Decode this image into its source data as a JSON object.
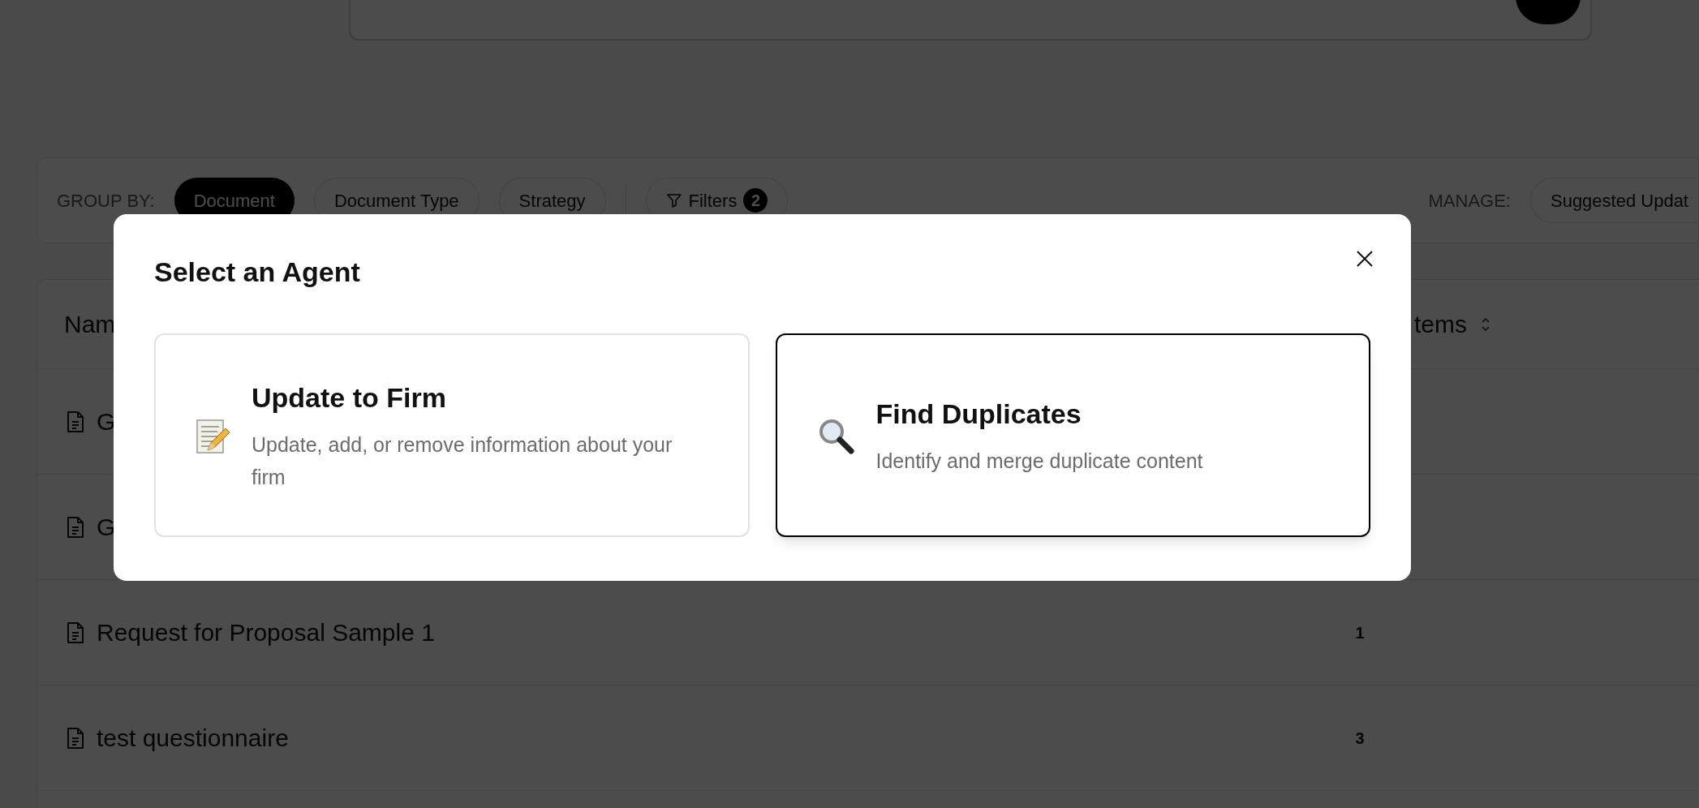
{
  "group_by": {
    "label": "GROUP BY:",
    "options": [
      {
        "label": "Document",
        "selected": true
      },
      {
        "label": "Document Type",
        "selected": false
      },
      {
        "label": "Strategy",
        "selected": false
      }
    ]
  },
  "filters": {
    "label": "Filters",
    "count": "2"
  },
  "manage": {
    "label": "MANAGE:",
    "button": "Suggested Updat"
  },
  "table": {
    "columns": [
      "Nam",
      "tems"
    ],
    "rows": [
      {
        "name": "G"
      },
      {
        "name": "G"
      },
      {
        "name": "Request for Proposal Sample 1",
        "count": "1"
      },
      {
        "name": "test questionnaire",
        "count": "3"
      }
    ]
  },
  "modal": {
    "title": "Select an Agent",
    "agents": [
      {
        "title": "Update to Firm",
        "description": "Update, add, or remove information about your firm",
        "selected": false
      },
      {
        "title": "Find Duplicates",
        "description": "Identify and merge duplicate content",
        "selected": true
      }
    ]
  }
}
